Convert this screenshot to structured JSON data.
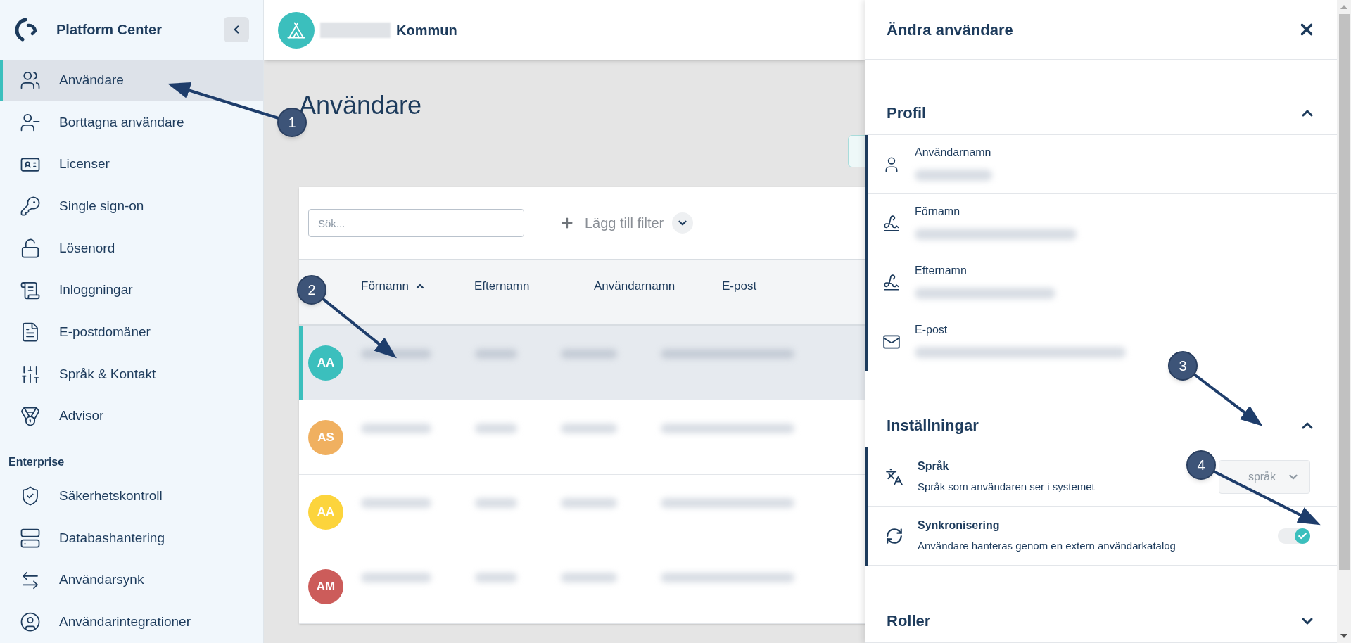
{
  "sidebar": {
    "brand": "Platform Center",
    "items": [
      {
        "label": "Användare",
        "selected": true
      },
      {
        "label": "Borttagna användare",
        "selected": false
      },
      {
        "label": "Licenser",
        "selected": false
      },
      {
        "label": "Single sign-on",
        "selected": false
      },
      {
        "label": "Lösenord",
        "selected": false
      },
      {
        "label": "Inloggningar",
        "selected": false
      },
      {
        "label": "E-postdomäner",
        "selected": false
      },
      {
        "label": "Språk & Kontakt",
        "selected": false
      },
      {
        "label": "Advisor",
        "selected": false
      }
    ],
    "section": "Enterprise",
    "enterprise_items": [
      {
        "label": "Säkerhetskontroll",
        "selected": false
      },
      {
        "label": "Databashantering",
        "selected": false
      },
      {
        "label": "Användarsynk",
        "selected": false
      },
      {
        "label": "Användarintegrationer",
        "selected": false
      }
    ]
  },
  "header": {
    "organization": "Kommun"
  },
  "page": {
    "title": "Användare",
    "search": {
      "placeholder": "Sök..."
    },
    "filter_button": "Lägg till filter",
    "columns": [
      {
        "label": "Förnamn",
        "sorted": true
      },
      {
        "label": "Efternamn",
        "sorted": false
      },
      {
        "label": "Användarnamn",
        "sorted": false
      },
      {
        "label": "E-post",
        "sorted": false
      }
    ],
    "rows": [
      {
        "initials": "AA",
        "color": "#3bbfbd",
        "selected": true
      },
      {
        "initials": "AS",
        "color": "#f0b060",
        "selected": false
      },
      {
        "initials": "AA",
        "color": "#fcd43c",
        "selected": false
      },
      {
        "initials": "AM",
        "color": "#cc5c5a",
        "selected": false
      }
    ]
  },
  "panel": {
    "title": "Ändra användare",
    "profile": {
      "title": "Profil",
      "expanded": true,
      "fields": [
        {
          "kind": "user",
          "label": "Användarnamn"
        },
        {
          "kind": "signature",
          "label": "Förnamn"
        },
        {
          "kind": "signature",
          "label": "Efternamn"
        },
        {
          "kind": "mail",
          "label": "E-post"
        }
      ]
    },
    "settings": {
      "title": "Inställningar",
      "expanded": true,
      "rows": [
        {
          "kind": "select",
          "label": "Språk",
          "description": "Språk som användaren ser i systemet",
          "placeholder": "språk",
          "disabled": true
        },
        {
          "kind": "toggle",
          "label": "Synkronisering",
          "description": "Användare hanteras genom en extern användarkatalog",
          "on": true,
          "disabled": true
        }
      ]
    },
    "roles": {
      "title": "Roller",
      "expanded": false
    }
  },
  "annotations": [
    {
      "number": "1"
    },
    {
      "number": "2"
    },
    {
      "number": "3"
    },
    {
      "number": "4"
    }
  ]
}
